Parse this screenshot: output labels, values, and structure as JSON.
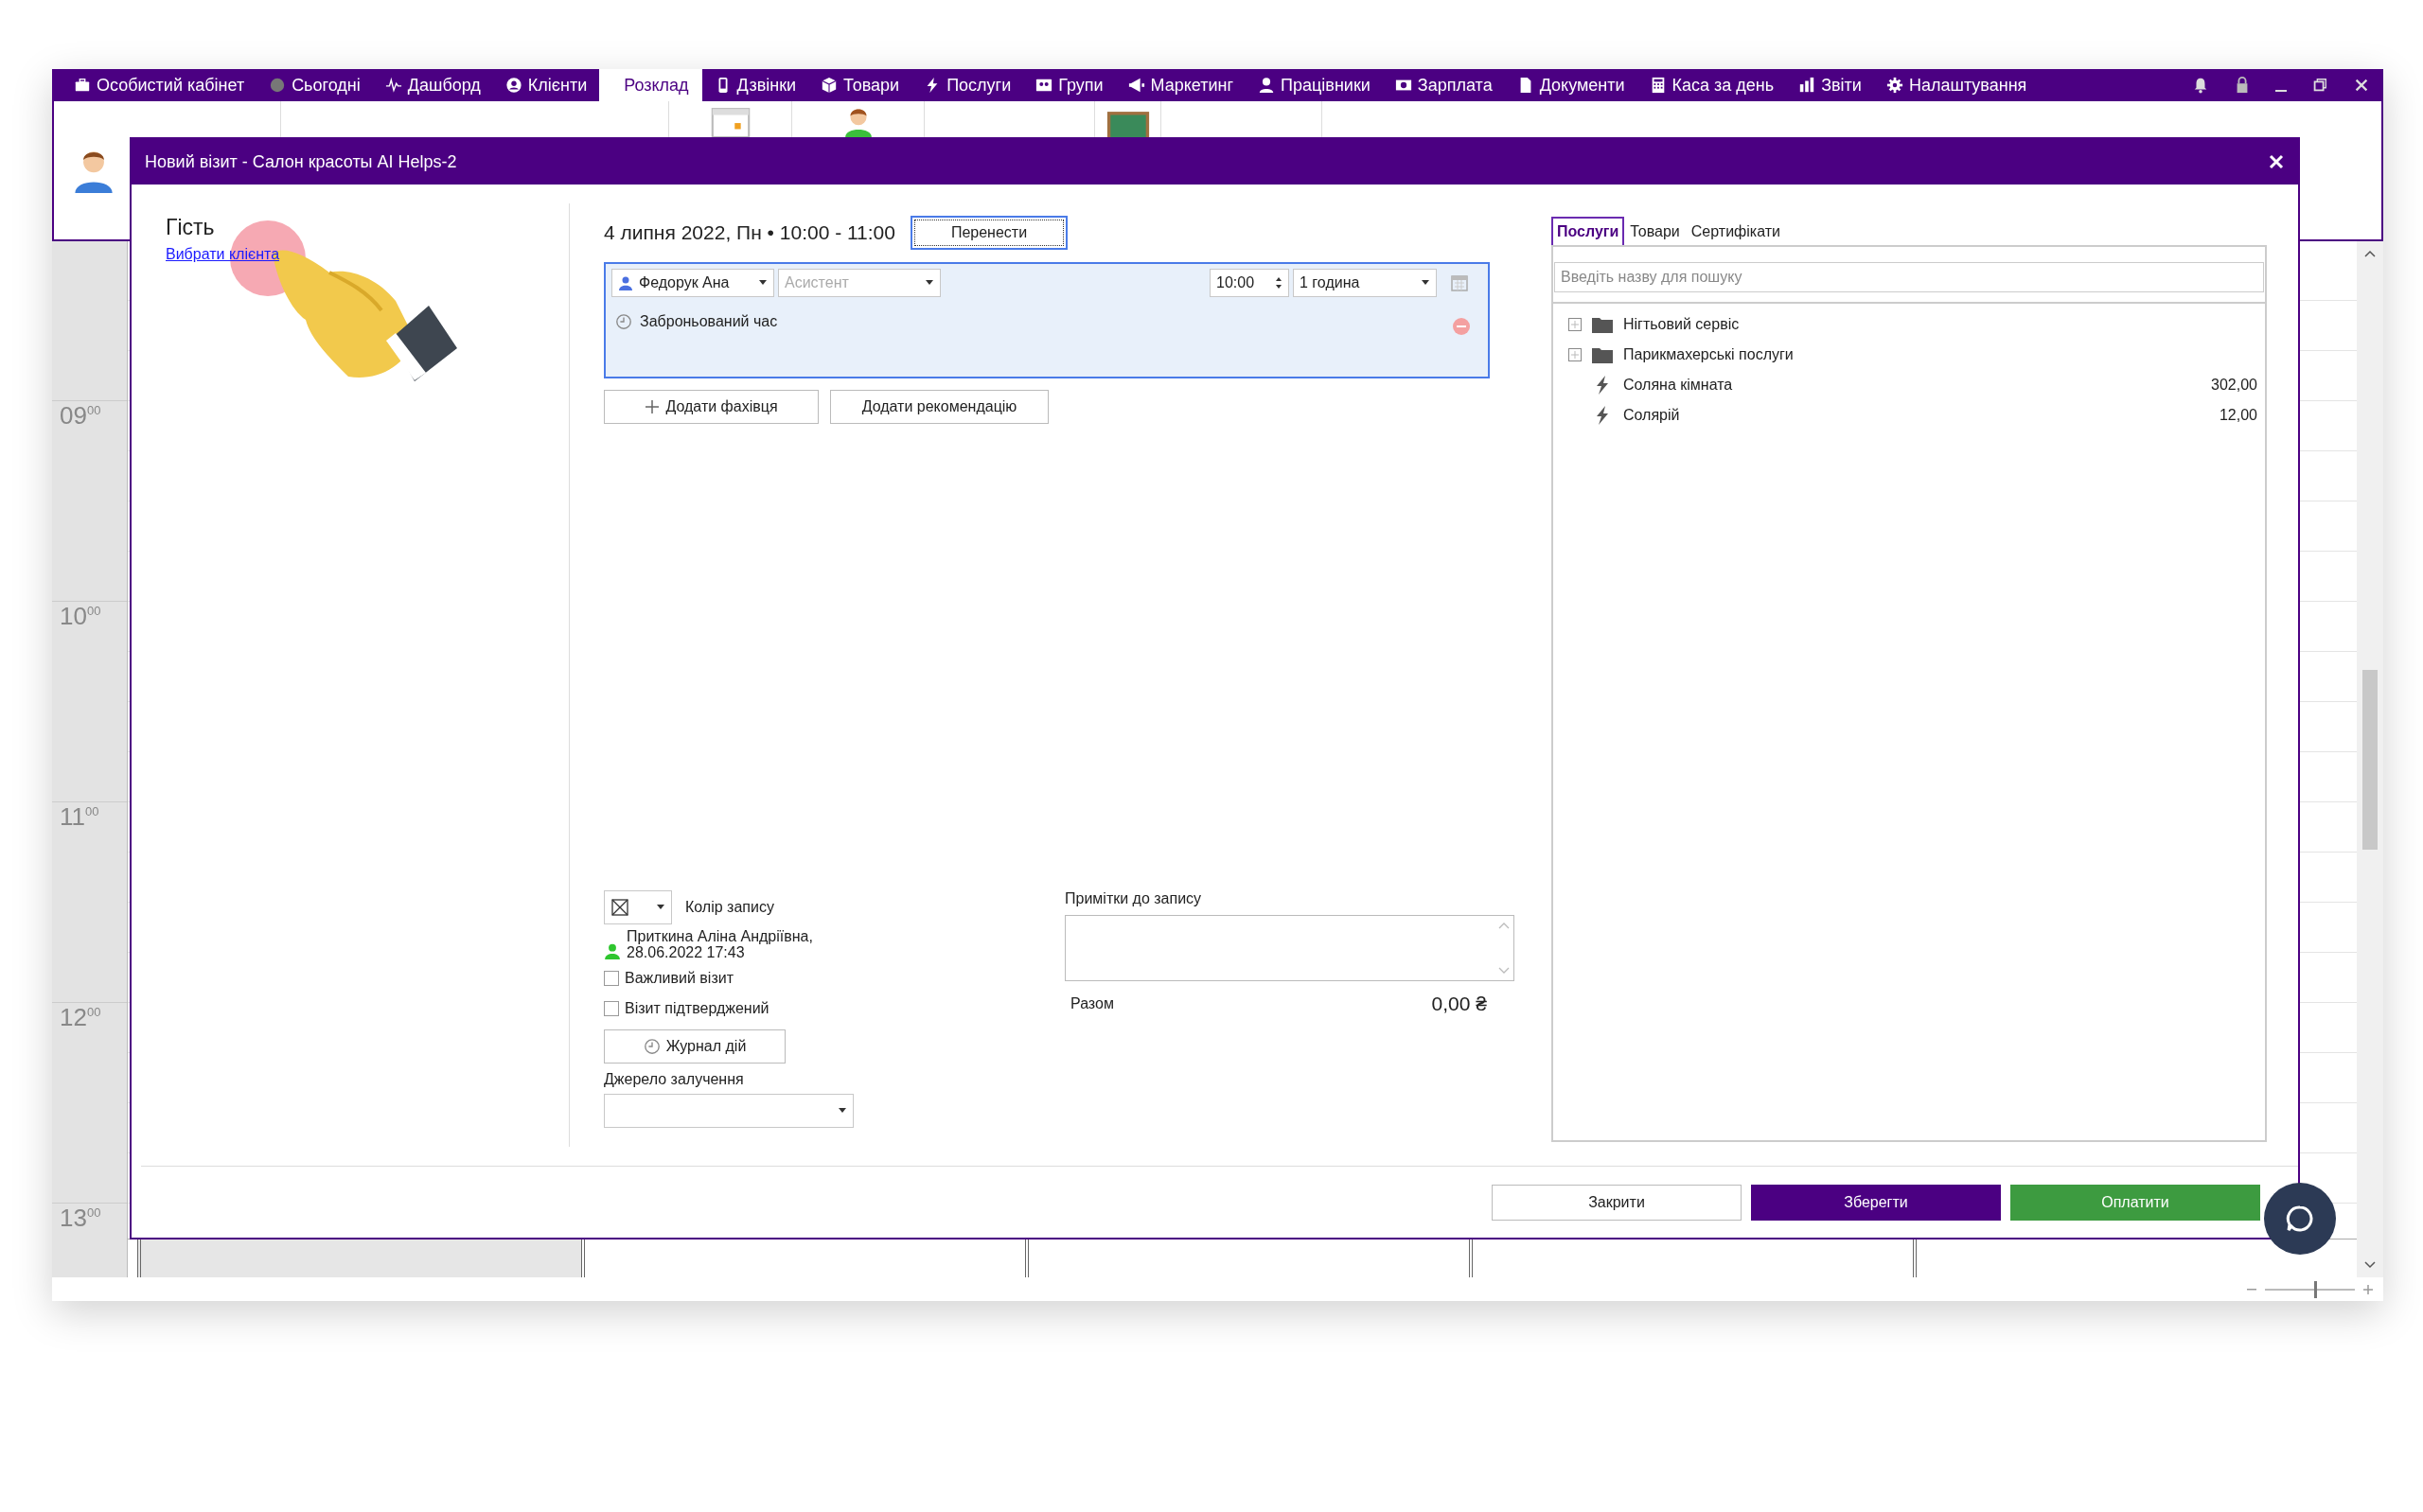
{
  "menu": {
    "items": [
      {
        "label": "Особистий кабінет",
        "selected": false
      },
      {
        "label": "Сьогодні",
        "selected": false
      },
      {
        "label": "Дашборд",
        "selected": false
      },
      {
        "label": "Клієнти",
        "selected": false
      },
      {
        "label": "Розклад",
        "selected": true
      },
      {
        "label": "Дзвінки",
        "selected": false
      },
      {
        "label": "Товари",
        "selected": false
      },
      {
        "label": "Послуги",
        "selected": false
      },
      {
        "label": "Групи",
        "selected": false
      },
      {
        "label": "Маркетинг",
        "selected": false
      },
      {
        "label": "Працівники",
        "selected": false
      },
      {
        "label": "Зарплата",
        "selected": false
      },
      {
        "label": "Документи",
        "selected": false
      },
      {
        "label": "Каса за день",
        "selected": false
      },
      {
        "label": "Звіти",
        "selected": false
      },
      {
        "label": "Налаштування",
        "selected": false
      }
    ]
  },
  "calendar": {
    "times": [
      "09$^{00}$",
      "10$^{00}$",
      "11$^{00}$",
      "12$^{00}$",
      "13$^{00}$"
    ]
  },
  "dialog": {
    "title": "Новий візит - Салон красоты AI Helps-2",
    "guest": {
      "heading": "Гість",
      "link": "Вибрати клієнта"
    },
    "visit": {
      "datetime": "4 липня 2022, Пн • 10:00 - 11:00",
      "reschedule_button": "Перенести",
      "specialist": {
        "name": "Федорук Ана",
        "assistant_placeholder": "Асистент",
        "time": "10:00",
        "duration": "1 година",
        "status": "Заброньований час"
      },
      "buttons": [
        "Додати фахівця",
        "Додати рекомендацію"
      ],
      "color_label": "Колір запису",
      "author": "Приткина Аліна Андріївна, 28.06.2022 17:43",
      "checkboxes": [
        {
          "label": "Важливий візит",
          "checked": false
        },
        {
          "label": "Візит підтверджений",
          "checked": false
        }
      ],
      "log_button": "Журнал дій",
      "source_label": "Джерело залучення",
      "notes_label": "Примітки до запису",
      "total": {
        "label": "Разом",
        "value": "0,00 ₴"
      }
    },
    "catalog": {
      "tabs": [
        {
          "label": "Послуги",
          "selected": true
        },
        {
          "label": "Товари",
          "selected": false
        },
        {
          "label": "Сертифікати",
          "selected": false
        }
      ],
      "search": {
        "placeholder": "Введіть назву для пошуку"
      },
      "items": [
        {
          "kind": "folder",
          "label": "Нігтьовий сервіс",
          "expanded": false
        },
        {
          "kind": "folder",
          "label": "Парикмахерські послуги",
          "expanded": false
        },
        {
          "kind": "service",
          "label": "Соляна кімната",
          "price": "302,00"
        },
        {
          "kind": "service",
          "label": "Солярій",
          "price": "12,00"
        }
      ]
    },
    "footer_buttons": [
      {
        "kind": "secondary",
        "label": "Закрити"
      },
      {
        "kind": "primary",
        "label": "Зберегти"
      },
      {
        "kind": "pay",
        "label": "Оплатити"
      }
    ]
  },
  "zoom_slider": {
    "level": 0.55
  }
}
